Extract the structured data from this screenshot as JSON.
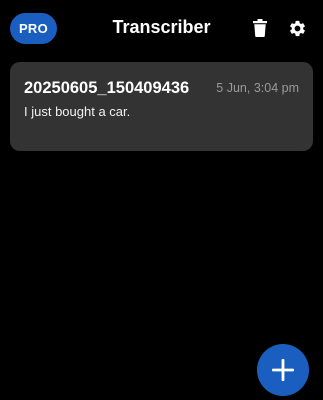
{
  "app_bar": {
    "badge_label": "PRO",
    "title": "Transcriber",
    "delete_icon": "trash-icon",
    "settings_icon": "gear-icon"
  },
  "transcripts": [
    {
      "title": "20250605_150409436",
      "date": "5 Jun, 3:04 pm",
      "text": "I just bought a car."
    }
  ],
  "fab": {
    "icon": "plus-icon"
  },
  "colors": {
    "background": "#000000",
    "card": "#333333",
    "accent": "#1a5fbf",
    "muted_text": "#9a9a9a"
  }
}
